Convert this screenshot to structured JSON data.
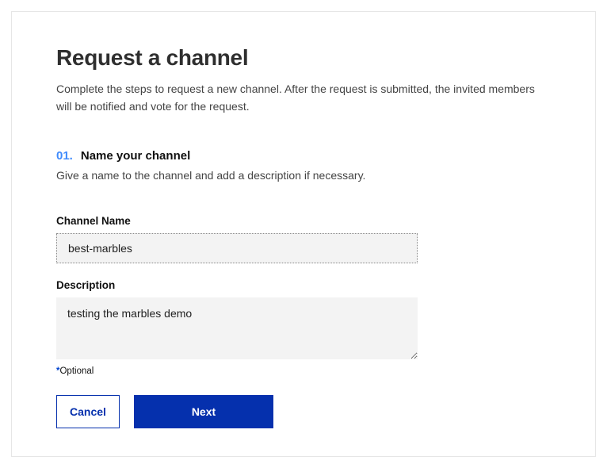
{
  "header": {
    "title": "Request a channel",
    "subtitle": "Complete the steps to request a new channel. After the request is submitted, the invited members will be notified and vote for the request."
  },
  "step": {
    "number": "01.",
    "title": "Name your channel",
    "description": "Give a name to the channel and add a description if necessary."
  },
  "form": {
    "channel_name_label": "Channel Name",
    "channel_name_value": "best-marbles",
    "description_label": "Description",
    "description_value": "testing the marbles demo",
    "optional_mark": "*",
    "optional_text": "Optional"
  },
  "buttons": {
    "cancel": "Cancel",
    "next": "Next"
  }
}
